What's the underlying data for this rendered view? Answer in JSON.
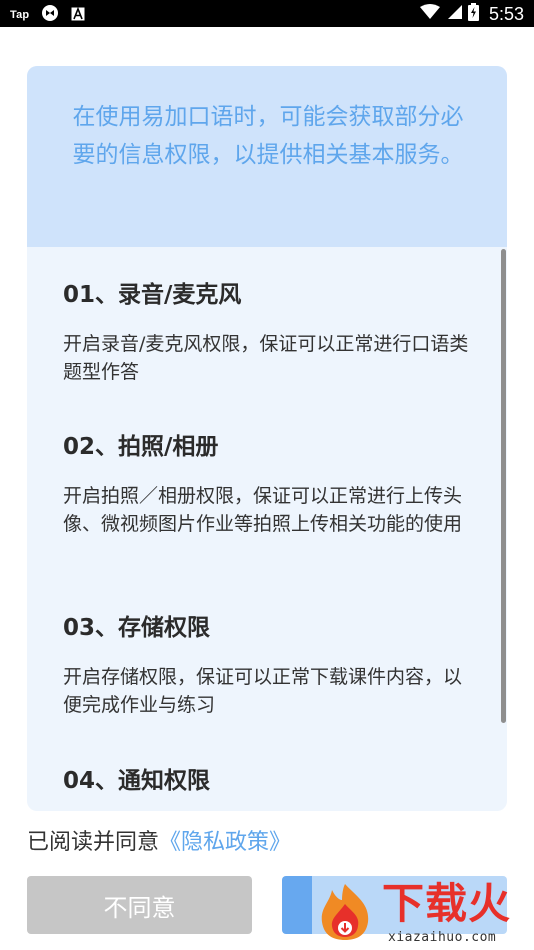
{
  "status_bar": {
    "left_label": "Tap",
    "time": "5:53",
    "icons": [
      "app-logo-icon",
      "notification-a-icon",
      "wifi-icon",
      "signal-icon",
      "battery-icon"
    ]
  },
  "dialog": {
    "intro": "在使用易加口语时，可能会获取部分必要的信息权限，以提供相关基本服务。",
    "sections": [
      {
        "title": "01、录音/麦克风",
        "desc": "开启录音/麦克风权限，保证可以正常进行口语类题型作答"
      },
      {
        "title": "02、拍照/相册",
        "desc": "开启拍照／相册权限，保证可以正常进行上传头像、微视频图片作业等拍照上传相关功能的使用"
      },
      {
        "title": "03、存储权限",
        "desc": "开启存储权限，保证可以正常下载课件内容，以便完成作业与练习"
      },
      {
        "title": "04、通知权限",
        "desc": ""
      }
    ]
  },
  "consent": {
    "prefix": "已阅读并同意",
    "link": "《隐私政策》"
  },
  "buttons": {
    "disagree": "不同意",
    "agree": ""
  },
  "watermark": {
    "name": "下载火",
    "url": "xiazaihuo.com"
  },
  "colors": {
    "accent": "#5fa6ec",
    "header_bg": "#cfe3fb",
    "card_bg": "#eef5fd",
    "disagree_bg": "#c6c6c6",
    "agree_bg": "#67a8ef",
    "watermark_red": "#e7302a"
  }
}
